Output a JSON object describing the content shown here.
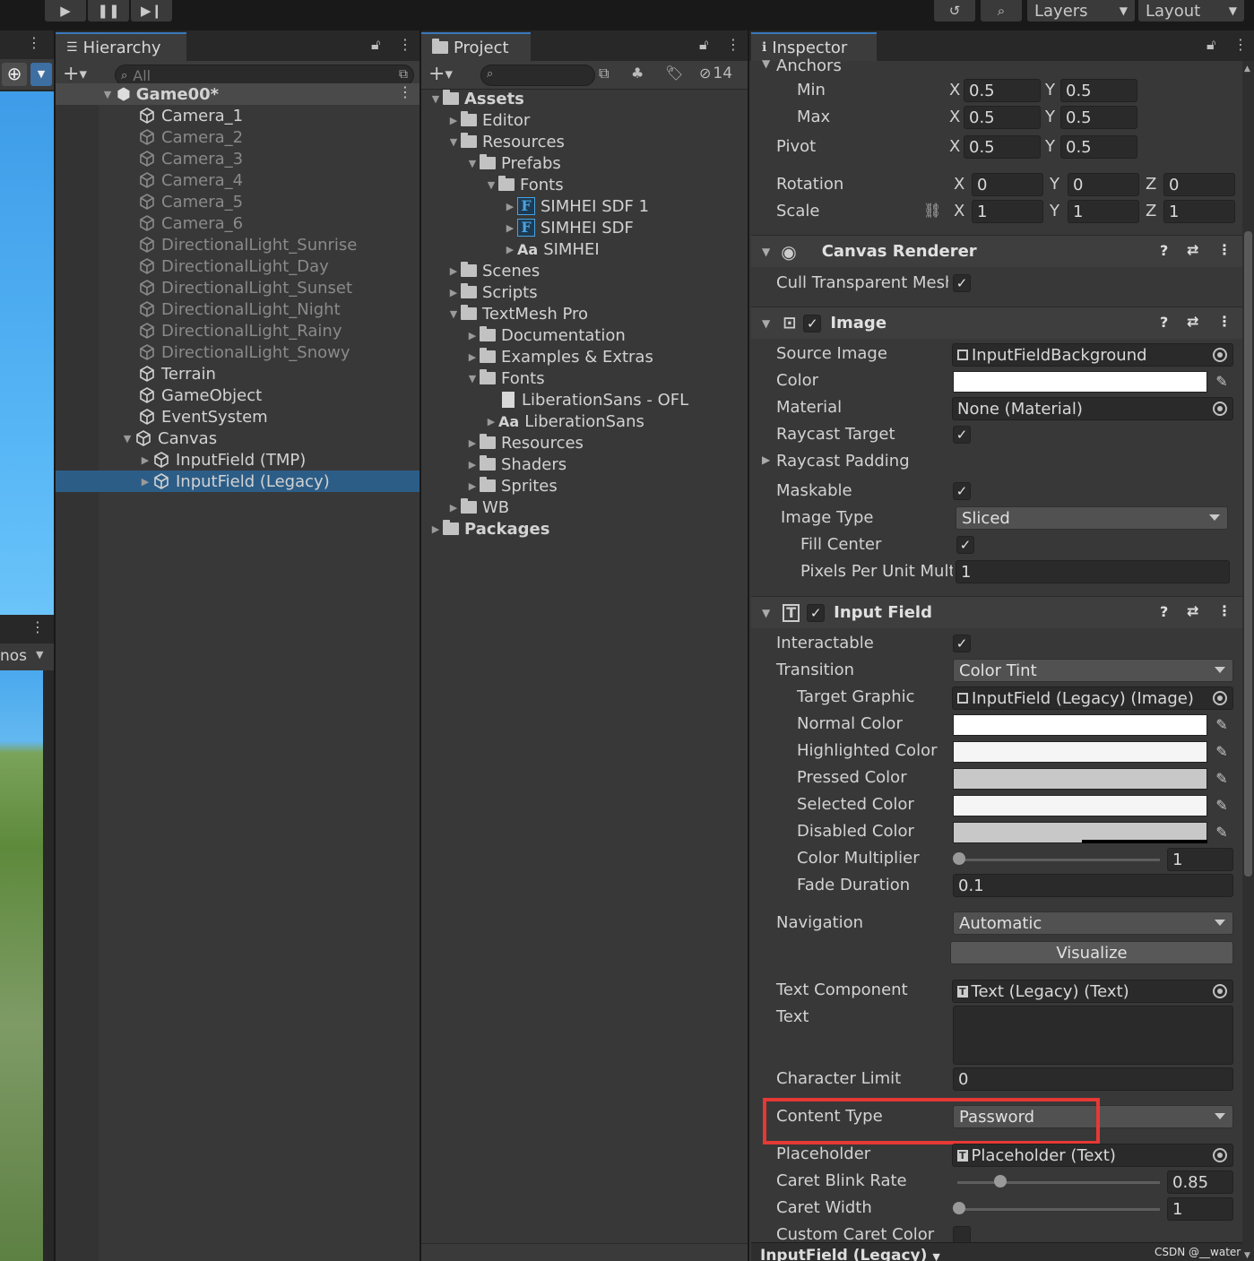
{
  "toolbar": {
    "layers": "Layers",
    "layout": "Layout"
  },
  "hierarchy": {
    "tab": "Hierarchy",
    "search_placeholder": "All",
    "scene": "Game00*",
    "items": [
      "Camera_1",
      "Camera_2",
      "Camera_3",
      "Camera_4",
      "Camera_5",
      "Camera_6",
      "DirectionalLight_Sunrise",
      "DirectionalLight_Day",
      "DirectionalLight_Sunset",
      "DirectionalLight_Night",
      "DirectionalLight_Rainy",
      "DirectionalLight_Snowy",
      "Terrain",
      "GameObject",
      "EventSystem",
      "Canvas",
      "InputField (TMP)",
      "InputField (Legacy)"
    ]
  },
  "scene_view": {
    "gizmos_partial": "nos"
  },
  "project": {
    "tab": "Project",
    "hidden_count": "14",
    "tree": [
      "Assets",
      "Editor",
      "Resources",
      "Prefabs",
      "Fonts",
      "SIMHEI SDF 1",
      "SIMHEI SDF",
      "SIMHEI",
      "Scenes",
      "Scripts",
      "TextMesh Pro",
      "Documentation",
      "Examples & Extras",
      "Fonts",
      "LiberationSans - OFL",
      "LiberationSans",
      "Resources",
      "Shaders",
      "Sprites",
      "WB",
      "Packages"
    ]
  },
  "inspector": {
    "tab": "Inspector",
    "anchors": "Anchors",
    "min": "Min",
    "max": "Max",
    "pivot": "Pivot",
    "rotation": "Rotation",
    "scale": "Scale",
    "x": "X",
    "y": "Y",
    "z": "Z",
    "anchor_min": [
      "0.5",
      "0.5"
    ],
    "anchor_max": [
      "0.5",
      "0.5"
    ],
    "pivot_v": [
      "0.5",
      "0.5"
    ],
    "rotation_v": [
      "0",
      "0",
      "0"
    ],
    "scale_v": [
      "1",
      "1",
      "1"
    ],
    "canvas_renderer": {
      "title": "Canvas Renderer",
      "cull": "Cull Transparent Mesh"
    },
    "image": {
      "title": "Image",
      "source_image": "Source Image",
      "source_value": "InputFieldBackground",
      "color": "Color",
      "material": "Material",
      "material_value": "None (Material)",
      "raycast_target": "Raycast Target",
      "raycast_padding": "Raycast Padding",
      "maskable": "Maskable",
      "image_type": "Image Type",
      "image_type_value": "Sliced",
      "fill_center": "Fill Center",
      "ppu": "Pixels Per Unit Multiplier",
      "ppu_value": "1"
    },
    "input_field": {
      "title": "Input Field",
      "interactable": "Interactable",
      "transition": "Transition",
      "transition_value": "Color Tint",
      "target_graphic": "Target Graphic",
      "target_graphic_value": "InputField (Legacy) (Image)",
      "normal_color": "Normal Color",
      "highlighted_color": "Highlighted Color",
      "pressed_color": "Pressed Color",
      "selected_color": "Selected Color",
      "disabled_color": "Disabled Color",
      "color_multiplier": "Color Multiplier",
      "color_multiplier_value": "1",
      "fade_duration": "Fade Duration",
      "fade_duration_value": "0.1",
      "navigation": "Navigation",
      "navigation_value": "Automatic",
      "visualize": "Visualize",
      "text_component": "Text Component",
      "text_component_value": "Text (Legacy) (Text)",
      "text": "Text",
      "character_limit": "Character Limit",
      "character_limit_value": "0",
      "content_type": "Content Type",
      "content_type_value": "Password",
      "placeholder": "Placeholder",
      "placeholder_value": "Placeholder (Text)",
      "caret_blink_rate": "Caret Blink Rate",
      "caret_blink_rate_value": "0.85",
      "caret_width": "Caret Width",
      "caret_width_value": "1",
      "custom_caret_color": "Custom Caret Color"
    },
    "colors": {
      "normal": "#ffffff",
      "highlighted": "#f5f5f5",
      "pressed": "#c8c8c8",
      "selected": "#f5f5f5",
      "disabled": "#c8c8c8",
      "highlight_box": "#e53935"
    },
    "footer": "InputField (Legacy)"
  },
  "watermark": "CSDN @__water"
}
